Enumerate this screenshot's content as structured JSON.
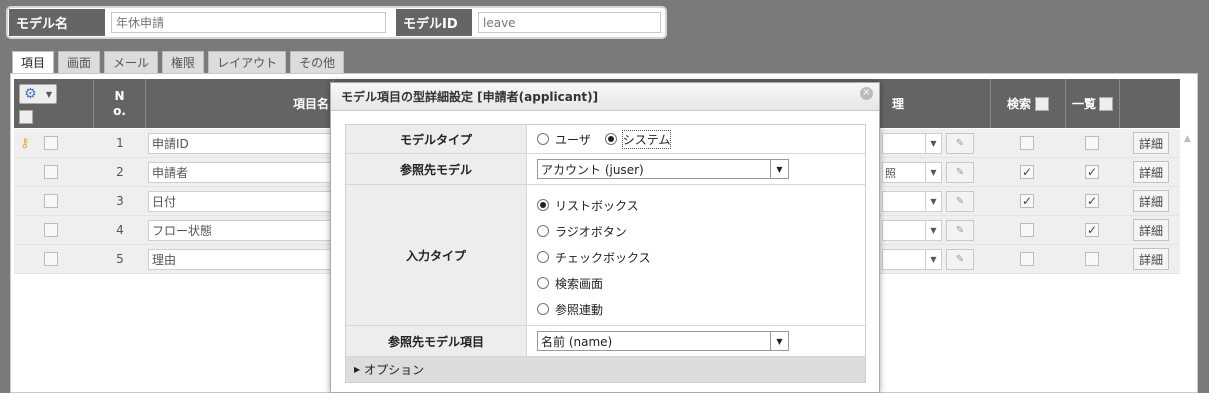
{
  "header": {
    "model_name_label": "モデル名",
    "model_name_value": "年休申請",
    "model_id_label": "モデルID",
    "model_id_value": "leave"
  },
  "tabs": [
    {
      "label": "項目",
      "active": true
    },
    {
      "label": "画面"
    },
    {
      "label": "メール"
    },
    {
      "label": "権限"
    },
    {
      "label": "レイアウト"
    },
    {
      "label": "その他"
    }
  ],
  "grid": {
    "col_no": "N\no.",
    "col_name": "項目名",
    "col_type_partial": "理",
    "col_search": "検索",
    "col_list": "一覧",
    "rows": [
      {
        "no": "1",
        "name": "申請ID",
        "sel": "",
        "search": false,
        "list": false,
        "detail": "詳細",
        "key": true
      },
      {
        "no": "2",
        "name": "申請者",
        "sel": "照",
        "search": true,
        "list": true,
        "detail": "詳細"
      },
      {
        "no": "3",
        "name": "日付",
        "sel": "",
        "search": true,
        "list": true,
        "detail": "詳細"
      },
      {
        "no": "4",
        "name": "フロー状態",
        "sel": "",
        "search": false,
        "list": true,
        "detail": "詳細"
      },
      {
        "no": "5",
        "name": "理由",
        "sel": "",
        "search": false,
        "list": false,
        "detail": "詳細"
      }
    ]
  },
  "modal": {
    "title": "モデル項目の型詳細設定 [申請者(applicant)]",
    "model_type_label": "モデルタイプ",
    "model_type_options": [
      "ユーザ",
      "システム"
    ],
    "model_type_selected": "システム",
    "ref_model_label": "参照先モデル",
    "ref_model_value": "アカウント (juser)",
    "input_type_label": "入力タイプ",
    "input_type_options": [
      "リストボックス",
      "ラジオボタン",
      "チェックボックス",
      "検索画面",
      "参照連動"
    ],
    "input_type_selected": "リストボックス",
    "ref_item_label": "参照先モデル項目",
    "ref_item_value": "名前 (name)",
    "options_label": "オプション"
  },
  "icons": {
    "gear": "gear-icon",
    "key": "key-icon",
    "edit": "edit-icon",
    "close": "close-icon"
  }
}
